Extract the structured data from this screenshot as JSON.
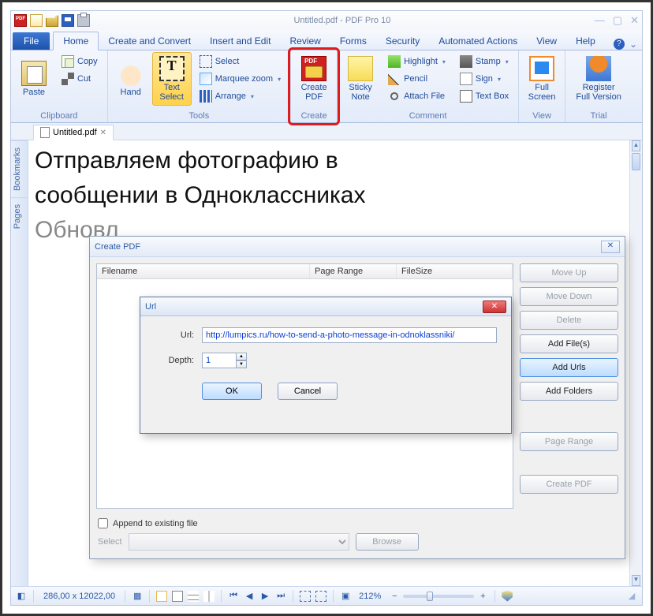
{
  "titlebar": {
    "title": "Untitled.pdf - PDF Pro 10"
  },
  "tabs": {
    "file": "File",
    "items": [
      "Home",
      "Create and Convert",
      "Insert and Edit",
      "Review",
      "Forms",
      "Security",
      "Automated Actions",
      "View",
      "Help"
    ],
    "active": "Home"
  },
  "ribbon": {
    "clipboard": {
      "title": "Clipboard",
      "paste": "Paste",
      "copy": "Copy",
      "cut": "Cut"
    },
    "tools": {
      "title": "Tools",
      "hand": "Hand",
      "text_select": "Text\nSelect",
      "select": "Select",
      "marquee": "Marquee zoom",
      "arrange": "Arrange"
    },
    "create": {
      "title": "Create",
      "create_pdf": "Create\nPDF"
    },
    "comment": {
      "title": "Comment",
      "sticky": "Sticky\nNote",
      "highlight": "Highlight",
      "pencil": "Pencil",
      "attach": "Attach File",
      "stamp": "Stamp",
      "sign": "Sign",
      "textbox": "Text Box"
    },
    "view": {
      "title": "View",
      "fullscreen": "Full\nScreen"
    },
    "trial": {
      "title": "Trial",
      "register": "Register\nFull Version"
    }
  },
  "doctab": {
    "name": "Untitled.pdf"
  },
  "sidebar": {
    "bookmarks": "Bookmarks",
    "pages": "Pages"
  },
  "document": {
    "line1": "Отправляем фотографию в",
    "line2": "сообщении в Одноклассниках",
    "line3": "Обновл"
  },
  "createpdf": {
    "title": "Create PDF",
    "headers": {
      "filename": "Filename",
      "pagerange": "Page Range",
      "filesize": "FileSize"
    },
    "buttons": {
      "move_up": "Move Up",
      "move_down": "Move Down",
      "delete": "Delete",
      "add_files": "Add File(s)",
      "add_urls": "Add Urls",
      "add_folders": "Add Folders",
      "page_range": "Page Range",
      "create_pdf": "Create PDF"
    },
    "append": "Append to existing file",
    "select_label": "Select",
    "browse": "Browse"
  },
  "urldlg": {
    "title": "Url",
    "url_label": "Url:",
    "url_value": "http://lumpics.ru/how-to-send-a-photo-message-in-odnoklassniki/",
    "depth_label": "Depth:",
    "depth_value": "1",
    "ok": "OK",
    "cancel": "Cancel"
  },
  "status": {
    "pos": "286,00 x 12022,00",
    "zoom": "212%"
  }
}
